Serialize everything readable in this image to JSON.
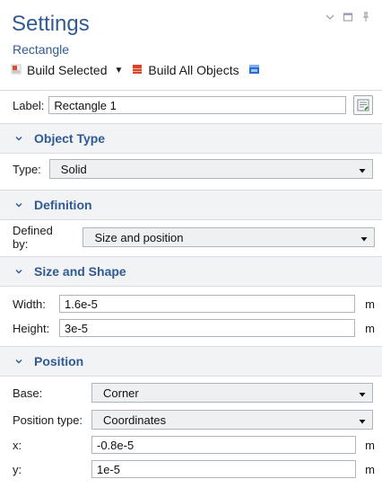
{
  "header": {
    "title": "Settings",
    "subtitle": "Rectangle",
    "toolbar": {
      "build_selected": "Build Selected",
      "build_all": "Build All Objects"
    }
  },
  "label_row": {
    "label": "Label:",
    "value": "Rectangle 1"
  },
  "sections": {
    "object_type": {
      "title": "Object Type",
      "type_label": "Type:",
      "type_value": "Solid"
    },
    "definition": {
      "title": "Definition",
      "defined_by_label": "Defined by:",
      "defined_by_value": "Size and position"
    },
    "size_shape": {
      "title": "Size and Shape",
      "width_label": "Width:",
      "width_value": "1.6e-5",
      "width_unit": "m",
      "height_label": "Height:",
      "height_value": "3e-5",
      "height_unit": "m"
    },
    "position": {
      "title": "Position",
      "base_label": "Base:",
      "base_value": "Corner",
      "position_type_label": "Position type:",
      "position_type_value": "Coordinates",
      "x_label": "x:",
      "x_value": "-0.8e-5",
      "x_unit": "m",
      "y_label": "y:",
      "y_value": "1e-5",
      "y_unit": "m"
    }
  },
  "colors": {
    "accent": "#2f5a93",
    "section_bg": "#f1f3f5"
  }
}
